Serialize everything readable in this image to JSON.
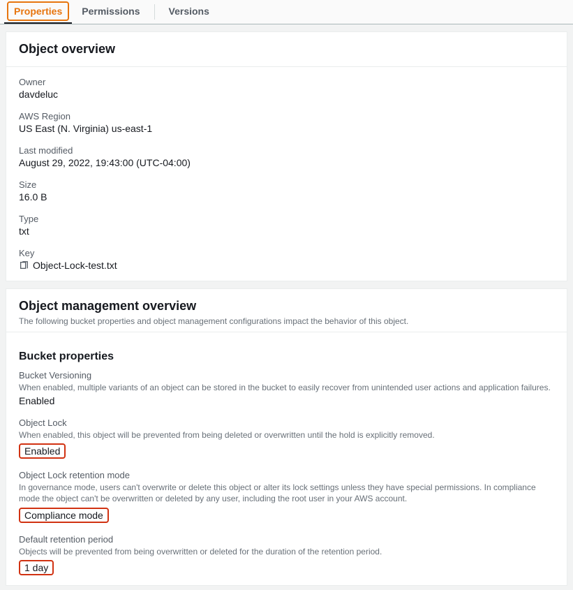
{
  "tabs": {
    "properties": "Properties",
    "permissions": "Permissions",
    "versions": "Versions"
  },
  "overview": {
    "title": "Object overview",
    "owner_label": "Owner",
    "owner_value": "davdeluc",
    "region_label": "AWS Region",
    "region_value": "US East (N. Virginia) us-east-1",
    "modified_label": "Last modified",
    "modified_value": "August 29, 2022, 19:43:00 (UTC-04:00)",
    "size_label": "Size",
    "size_value": "16.0 B",
    "type_label": "Type",
    "type_value": "txt",
    "key_label": "Key",
    "key_value": "Object-Lock-test.txt"
  },
  "mgmt": {
    "title": "Object management overview",
    "sub": "The following bucket properties and object management configurations impact the behavior of this object.",
    "bucket_title": "Bucket properties",
    "versioning_label": "Bucket Versioning",
    "versioning_desc": "When enabled, multiple variants of an object can be stored in the bucket to easily recover from unintended user actions and application failures.",
    "versioning_value": "Enabled",
    "lock_label": "Object Lock",
    "lock_desc": "When enabled, this object will be prevented from being deleted or overwritten until the hold is explicitly removed.",
    "lock_value": "Enabled",
    "mode_label": "Object Lock retention mode",
    "mode_desc": "In governance mode, users can't overwrite or delete this object or alter its lock settings unless they have special permissions. In compliance mode the object can't be overwritten or deleted by any user, including the root user in your AWS account.",
    "mode_value": "Compliance mode",
    "retention_label": "Default retention period",
    "retention_desc": "Objects will be prevented from being overwritten or deleted for the duration of the retention period.",
    "retention_value": "1 day"
  }
}
